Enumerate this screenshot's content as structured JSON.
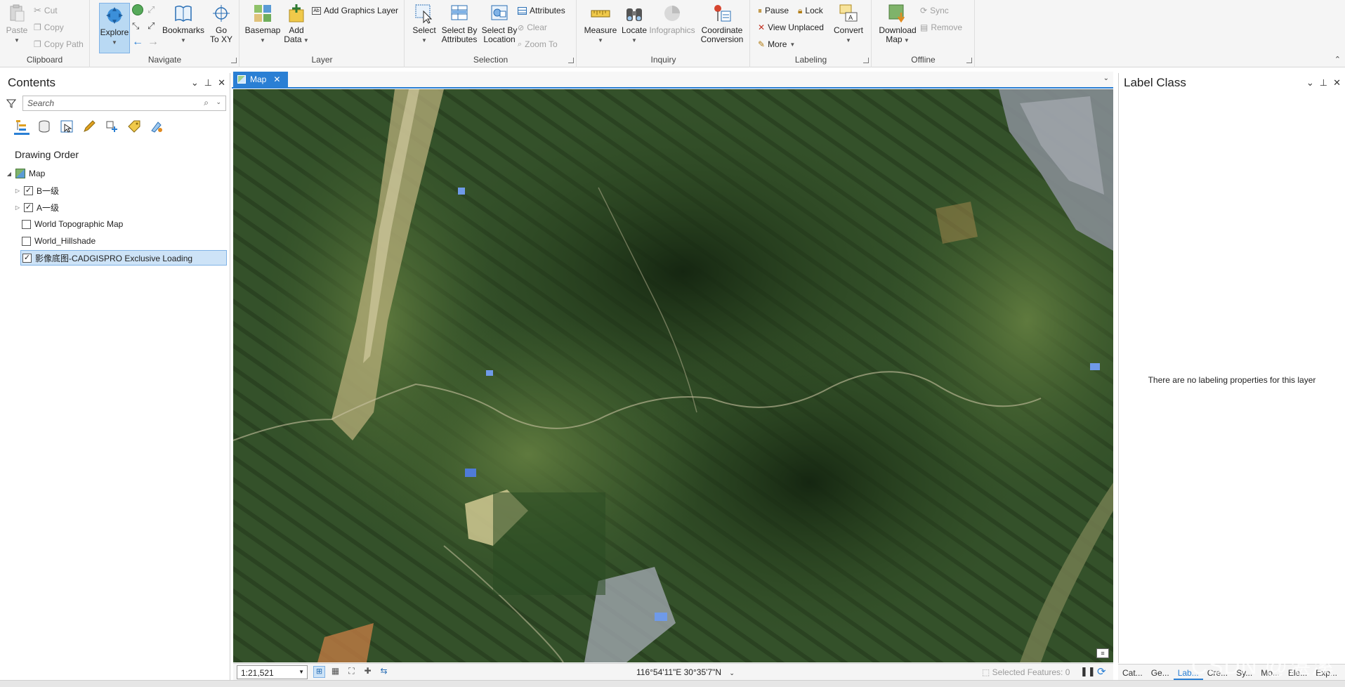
{
  "ribbon": {
    "clipboard": {
      "label": "Clipboard",
      "paste": "Paste",
      "cut": "Cut",
      "copy": "Copy",
      "copy_path": "Copy Path"
    },
    "navigate": {
      "label": "Navigate",
      "explore": "Explore",
      "bookmarks": "Bookmarks",
      "goto_xy_1": "Go",
      "goto_xy_2": "To XY"
    },
    "layer": {
      "label": "Layer",
      "basemap": "Basemap",
      "add_data_1": "Add",
      "add_data_2": "Data",
      "add_graphics": "Add Graphics Layer"
    },
    "selection": {
      "label": "Selection",
      "select": "Select",
      "select_by_attr_1": "Select By",
      "select_by_attr_2": "Attributes",
      "select_by_loc_1": "Select By",
      "select_by_loc_2": "Location",
      "attributes": "Attributes",
      "clear": "Clear",
      "zoom_to": "Zoom To"
    },
    "inquiry": {
      "label": "Inquiry",
      "measure": "Measure",
      "locate": "Locate",
      "infographics": "Infographics",
      "coord_conv_1": "Coordinate",
      "coord_conv_2": "Conversion"
    },
    "labeling": {
      "label": "Labeling",
      "pause": "Pause",
      "lock": "Lock",
      "view_unplaced": "View Unplaced",
      "more": "More",
      "convert": "Convert"
    },
    "offline": {
      "label": "Offline",
      "download_1": "Download",
      "download_2": "Map",
      "sync": "Sync",
      "remove": "Remove"
    }
  },
  "contents": {
    "title": "Contents",
    "search_placeholder": "Search",
    "drawing_order": "Drawing Order",
    "layers": [
      {
        "name": "Map"
      },
      {
        "name": "B一级",
        "checked": true
      },
      {
        "name": "A一级",
        "checked": true
      },
      {
        "name": "World Topographic Map",
        "checked": false
      },
      {
        "name": "World_Hillshade",
        "checked": false
      },
      {
        "name": "影像底图-CADGISPRO Exclusive Loading",
        "checked": true
      }
    ]
  },
  "map": {
    "tab_label": "Map",
    "scale": "1:21,521",
    "coordinates": "116°54'11\"E 30°35'7\"N",
    "selected_features": "Selected Features: 0"
  },
  "label_pane": {
    "title": "Label Class",
    "message": "There are no labeling properties for this layer"
  },
  "bottom_tabs": [
    "Cat...",
    "Ge...",
    "Lab...",
    "Cre...",
    "Sy...",
    "Mo...",
    "Ele...",
    "Exp..."
  ],
  "watermark": "CSDN @湛溪"
}
